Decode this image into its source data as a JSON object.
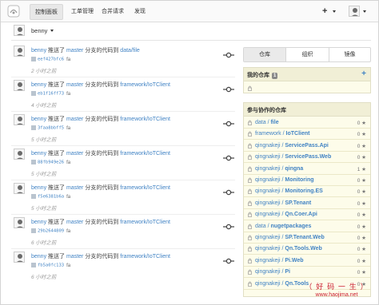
{
  "nav": {
    "tabs": [
      "控制面板",
      "工单管理",
      "合并请求",
      "发现"
    ],
    "plus": "+"
  },
  "user": {
    "name": "benny"
  },
  "feed": [
    {
      "actor": "benny",
      "verb": "推送了",
      "branch": "master",
      "mid": "分支的代码到",
      "repo": "data/file",
      "sha": "eef427bfc6",
      "msg": "fa",
      "time": "2 小时之前"
    },
    {
      "actor": "benny",
      "verb": "推送了",
      "branch": "master",
      "mid": "分支的代码到",
      "repo": "framework/IoTClient",
      "sha": "eb1f16ff73",
      "msg": "fa",
      "time": "4 小时之前"
    },
    {
      "actor": "benny",
      "verb": "推送了",
      "branch": "master",
      "mid": "分支的代码到",
      "repo": "framework/IoTClient",
      "sha": "3faa8bbff5",
      "msg": "fa",
      "time": "5 小时之前"
    },
    {
      "actor": "benny",
      "verb": "推送了",
      "branch": "master",
      "mid": "分支的代码到",
      "repo": "framework/IoTClient",
      "sha": "88fb949e26",
      "msg": "fa",
      "time": "5 小时之前"
    },
    {
      "actor": "benny",
      "verb": "推送了",
      "branch": "master",
      "mid": "分支的代码到",
      "repo": "framework/IoTClient",
      "sha": "f5e6381b6a",
      "msg": "fa",
      "time": "5 小时之前"
    },
    {
      "actor": "benny",
      "verb": "推送了",
      "branch": "master",
      "mid": "分支的代码到",
      "repo": "framework/IoTClient",
      "sha": "29b2644809",
      "msg": "fa",
      "time": "6 小时之前"
    },
    {
      "actor": "benny",
      "verb": "推送了",
      "branch": "master",
      "mid": "分支的代码到",
      "repo": "framework/IoTClient",
      "sha": "fb5a0fc133",
      "msg": "fa",
      "time": "6 小时之前"
    }
  ],
  "right": {
    "tabs": [
      "仓库",
      "组织",
      "镜像"
    ],
    "my_repos_title": "我的仓库",
    "my_repos_count": "1",
    "my_repos_plus": "+",
    "collab_title": "参与协作的仓库",
    "collab_repos": [
      {
        "owner": "data",
        "name": "file",
        "stars": "0"
      },
      {
        "owner": "framework",
        "name": "IoTClient",
        "stars": "0"
      },
      {
        "owner": "qingnakeji",
        "name": "ServicePass.Api",
        "stars": "0"
      },
      {
        "owner": "qingnakeji",
        "name": "ServicePass.Web",
        "stars": "0"
      },
      {
        "owner": "qingnakeji",
        "name": "qingna",
        "stars": "1"
      },
      {
        "owner": "qingnakeji",
        "name": "Monitoring",
        "stars": "0"
      },
      {
        "owner": "qingnakeji",
        "name": "Monitoring.ES",
        "stars": "0"
      },
      {
        "owner": "qingnakeji",
        "name": "SP.Tenant",
        "stars": "0"
      },
      {
        "owner": "qingnakeji",
        "name": "Qn.Coer.Api",
        "stars": "0"
      },
      {
        "owner": "data",
        "name": "nugetpackages",
        "stars": "0"
      },
      {
        "owner": "qingnakeji",
        "name": "SP.Tenant.Web",
        "stars": "0"
      },
      {
        "owner": "qingnakeji",
        "name": "Qn.Tools.Web",
        "stars": "0"
      },
      {
        "owner": "qingnakeji",
        "name": "Pi.Web",
        "stars": "0"
      },
      {
        "owner": "qingnakeji",
        "name": "Pi",
        "stars": "0"
      },
      {
        "owner": "qingnakeji",
        "name": "Qn.Tools",
        "stars": "0"
      }
    ],
    "star_glyph": "★"
  },
  "watermark": {
    "line1": "（ 好 码 一 生 ）",
    "line2": "www.haojima.net"
  },
  "colors": {
    "link": "#4183c4",
    "panel_bg": "#fdfcea",
    "panel_head": "#f1efd6"
  }
}
